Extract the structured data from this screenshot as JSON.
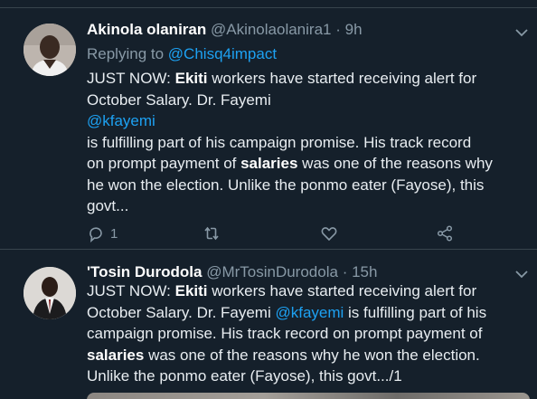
{
  "tweets": [
    {
      "name": "Akinola olaniran",
      "handle": "@Akinolaolanira1",
      "separator": "·",
      "time": "9h",
      "replying_prefix": "Replying to",
      "replying_to": "@Chisq4impact",
      "lines": [
        {
          "pre": "JUST NOW: ",
          "bold": "Ekiti",
          "post": " workers have started receiving alert for"
        },
        {
          "pre": "October Salary. Dr. Fayemi",
          "bold": "",
          "post": ""
        },
        {
          "pre": "",
          "bold": "",
          "post": "",
          "mention": "@kfayemi"
        },
        {
          "pre": " is fulfilling part of his campaign promise. His track record",
          "bold": "",
          "post": ""
        },
        {
          "pre": "on prompt payment of ",
          "bold": "salaries",
          "post": " was one of the reasons why"
        },
        {
          "pre": "he won the election. Unlike the ponmo eater (Fayose), this",
          "bold": "",
          "post": ""
        },
        {
          "pre": "govt...",
          "bold": "",
          "post": ""
        }
      ],
      "reply_count": "1",
      "retweet_count": "",
      "like_count": "",
      "icons": [
        "reply-icon",
        "retweet-icon",
        "like-icon",
        "share-icon"
      ]
    },
    {
      "name": "'Tosin Durodola",
      "handle": "@MrTosinDurodola",
      "separator": "·",
      "time": "15h",
      "lines": [
        {
          "pre": "JUST NOW: ",
          "bold": "Ekiti",
          "post": " workers have started receiving alert for"
        },
        {
          "pre": "October Salary. Dr. Fayemi ",
          "mention": "@kfayemi",
          "post": " is fulfilling part of his"
        },
        {
          "pre": "campaign promise. His track record on prompt payment of",
          "bold": "",
          "post": ""
        },
        {
          "pre": "",
          "bold": "salaries",
          "post": " was one of the reasons why he won the election."
        },
        {
          "pre": "Unlike the ponmo eater (Fayose), this govt.../1",
          "bold": "",
          "post": ""
        }
      ]
    }
  ],
  "colors": {
    "background": "#15202b",
    "text": "#e8edf1",
    "muted": "#8899a6",
    "link": "#1da1f2",
    "divider": "#38444d"
  }
}
